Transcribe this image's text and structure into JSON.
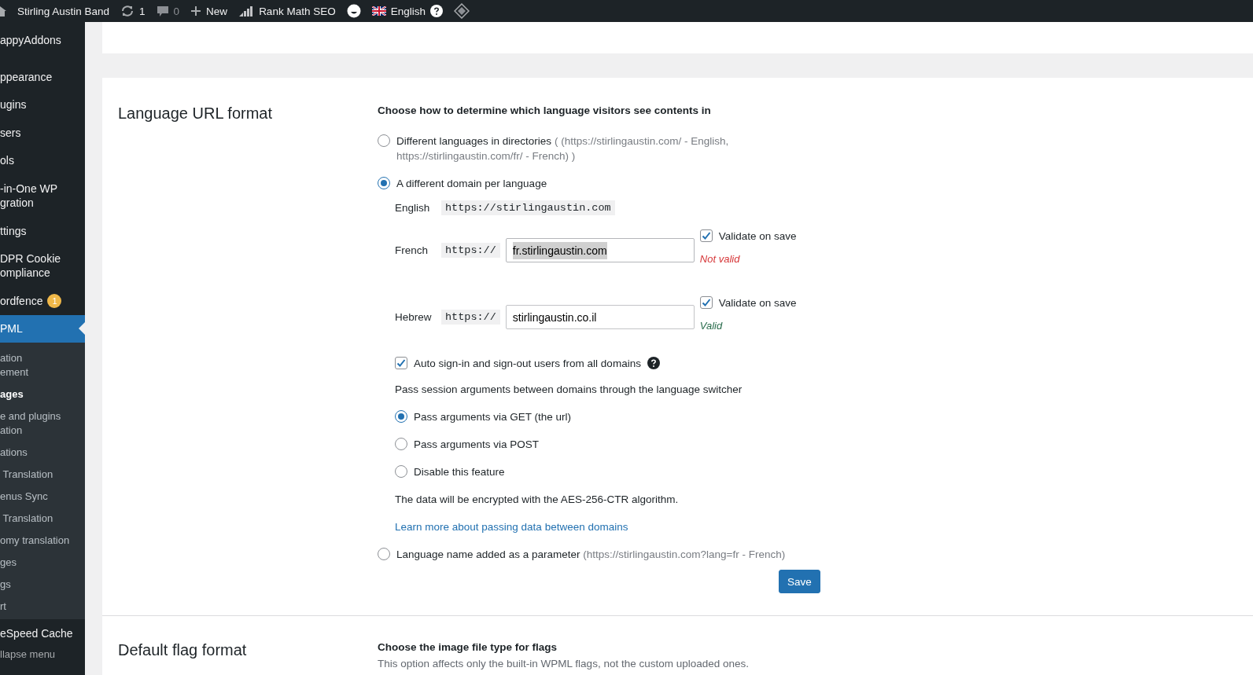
{
  "admin_bar": {
    "site": "Stirling Austin Band",
    "updates": "1",
    "comments": "0",
    "new": "New",
    "seo": "Rank Math SEO",
    "language": "English"
  },
  "sidebar": {
    "items": [
      {
        "label": "appyAddons",
        "selected": false
      },
      {
        "label": "ppearance",
        "selected": false
      },
      {
        "label": "ugins",
        "selected": false
      },
      {
        "label": "sers",
        "selected": false
      },
      {
        "label": "ols",
        "selected": false
      },
      {
        "label": "-in-One WP\ngration",
        "selected": false
      },
      {
        "label": "ttings",
        "selected": false
      },
      {
        "label": "DPR Cookie\nompliance",
        "selected": false
      },
      {
        "label": "ordfence",
        "badge": "1",
        "selected": false
      },
      {
        "label": "PML",
        "selected": true,
        "children": [
          {
            "label": "ation\nement",
            "selected": false
          },
          {
            "label": "ages",
            "selected": true
          },
          {
            "label": "e and plugins\nation",
            "selected": false
          },
          {
            "label": "ations",
            "selected": false
          },
          {
            "label": " Translation",
            "selected": false
          },
          {
            "label": "enus Sync",
            "selected": false
          },
          {
            "label": " Translation",
            "selected": false
          },
          {
            "label": "omy translation",
            "selected": false
          },
          {
            "label": "ges",
            "selected": false
          },
          {
            "label": "gs",
            "selected": false
          },
          {
            "label": "rt",
            "selected": false
          }
        ]
      },
      {
        "label": "eSpeed Cache",
        "selected": false
      }
    ],
    "collapse": "llapse menu"
  },
  "url_format": {
    "title": "Language URL format",
    "heading": "Choose how to determine which language visitors see contents in",
    "options": [
      {
        "kind": "plain",
        "label": "Different languages in directories",
        "hint": "( (https://stirlingaustin.com/ - English, https://stirlingaustin.com/fr/ - French) )",
        "selected": false
      },
      {
        "kind": "domains",
        "label": "A different domain per language",
        "selected": true,
        "domains": [
          {
            "kind": "fixed",
            "language": "English",
            "url": "https://stirlingaustin.com"
          },
          {
            "kind": "input",
            "language": "French",
            "prefix": "https://",
            "value": "fr.stirlingaustin.com",
            "text_selected": true,
            "validate": {
              "label": "Validate on save",
              "checked": true
            },
            "status": {
              "text": "Not valid",
              "valid": false
            }
          },
          {
            "kind": "input",
            "language": "Hebrew",
            "prefix": "https://",
            "value": "stirlingaustin.co.il",
            "text_selected": false,
            "validate": {
              "label": "Validate on save",
              "checked": true
            },
            "status": {
              "text": "Valid",
              "valid": true
            }
          }
        ],
        "auto_sign": {
          "label": "Auto sign-in and sign-out users from all domains",
          "checked": true
        },
        "session_label": "Pass session arguments between domains through the language switcher",
        "session_options": [
          {
            "label": "Pass arguments via GET (the url)",
            "selected": true
          },
          {
            "label": "Pass arguments via POST",
            "selected": false
          },
          {
            "label": "Disable this feature",
            "selected": false
          }
        ],
        "note": "The data will be encrypted with the AES-256-CTR algorithm.",
        "link": "Learn more about passing data between domains"
      },
      {
        "kind": "plain",
        "label": "Language name added as a parameter",
        "hint": "(https://stirlingaustin.com?lang=fr - French)",
        "selected": false
      }
    ],
    "save": "Save"
  },
  "flag_format": {
    "title": "Default flag format",
    "heading": "Choose the image file type for flags",
    "description": "This option affects only the built-in WPML flags, not the custom uploaded ones."
  }
}
